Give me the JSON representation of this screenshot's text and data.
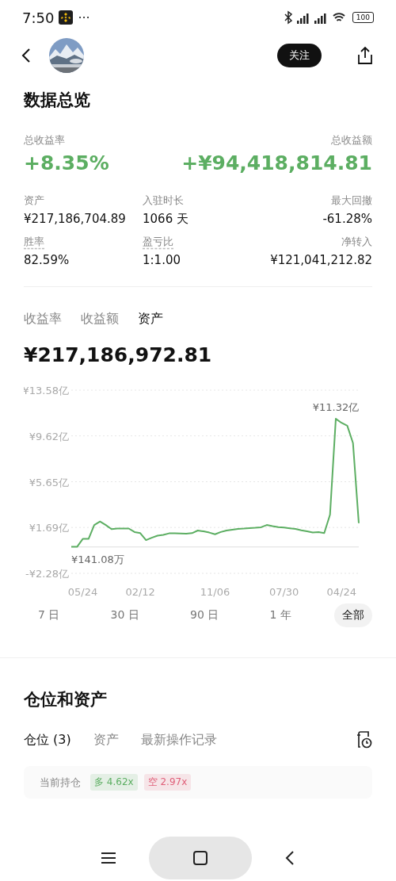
{
  "status_bar": {
    "time": "7:50",
    "more": "···",
    "battery": "100"
  },
  "header": {
    "follow_button": "关注"
  },
  "overview": {
    "title": "数据总览",
    "total_rate": {
      "label": "总收益率",
      "value": "+8.35%"
    },
    "total_amount": {
      "label": "总收益额",
      "value": "+¥94,418,814.81"
    },
    "stats": [
      {
        "label": "资产",
        "value": "¥217,186,704.89",
        "underlined": false
      },
      {
        "label": "入驻时长",
        "value": "1066 天",
        "underlined": false
      },
      {
        "label": "最大回撤",
        "value": "-61.28%",
        "underlined": false
      },
      {
        "label": "胜率",
        "value": "82.59%",
        "underlined": true
      },
      {
        "label": "盈亏比",
        "value": "1:1.00",
        "underlined": true
      },
      {
        "label": "净转入",
        "value": "¥121,041,212.82",
        "underlined": false
      }
    ]
  },
  "chart_tabs": [
    {
      "label": "收益率",
      "selected": false
    },
    {
      "label": "收益额",
      "selected": false
    },
    {
      "label": "资产",
      "selected": true
    }
  ],
  "chart_value": "¥217,186,972.81",
  "chart_data": {
    "type": "line",
    "grid": true,
    "ylim": [
      -2.28,
      13.58
    ],
    "yticks": [
      {
        "value": 13.58,
        "label": "¥13.58亿"
      },
      {
        "value": 9.62,
        "label": "¥9.62亿"
      },
      {
        "value": 5.65,
        "label": "¥5.65亿"
      },
      {
        "value": 1.69,
        "label": "¥1.69亿"
      },
      {
        "value": -2.28,
        "label": "-¥2.28亿"
      }
    ],
    "categories": [
      null,
      null,
      "05/24",
      null,
      null,
      null,
      null,
      null,
      null,
      null,
      null,
      null,
      "02/12",
      null,
      null,
      null,
      null,
      null,
      null,
      null,
      null,
      null,
      null,
      null,
      null,
      "11/06",
      null,
      null,
      null,
      null,
      null,
      null,
      null,
      null,
      null,
      null,
      null,
      "07/30",
      null,
      null,
      null,
      null,
      null,
      null,
      null,
      null,
      null,
      "04/24",
      null,
      null,
      null
    ],
    "series": [
      {
        "color": "#5cae62",
        "values": [
          0.01,
          0.01,
          0.7,
          0.7,
          1.9,
          2.2,
          1.9,
          1.55,
          1.6,
          1.6,
          1.6,
          1.3,
          1.2,
          0.6,
          0.8,
          0.98,
          1.05,
          1.18,
          1.18,
          1.17,
          1.16,
          1.2,
          1.43,
          1.35,
          1.25,
          1.1,
          1.3,
          1.43,
          1.5,
          1.57,
          1.6,
          1.64,
          1.67,
          1.71,
          1.9,
          1.8,
          1.72,
          1.68,
          1.62,
          1.56,
          1.45,
          1.35,
          1.25,
          1.3,
          1.2,
          2.8,
          11.1,
          10.75,
          10.5,
          9.0,
          2.06
        ]
      }
    ],
    "annotations": [
      "¥11.32亿",
      "¥141.08万"
    ]
  },
  "ranges": [
    {
      "label": "7 日",
      "selected": false
    },
    {
      "label": "30 日",
      "selected": false
    },
    {
      "label": "90 日",
      "selected": false
    },
    {
      "label": "1 年",
      "selected": false
    },
    {
      "label": "全部",
      "selected": true
    }
  ],
  "positions": {
    "title": "仓位和资产",
    "tabs": [
      {
        "label": "仓位 (3)",
        "selected": true
      },
      {
        "label": "资产",
        "selected": false
      },
      {
        "label": "最新操作记录",
        "selected": false
      }
    ],
    "card": {
      "label": "当前持仓",
      "tags": [
        {
          "text": "多 4.62x",
          "color": "#5cae62"
        },
        {
          "text": "空 2.97x",
          "color": "#e0607a"
        }
      ]
    }
  }
}
